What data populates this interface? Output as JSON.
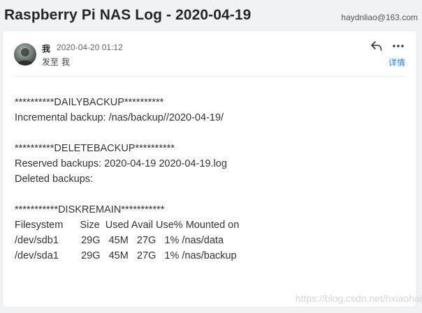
{
  "email": {
    "subject": "Raspberry Pi NAS Log - 2020-04-19",
    "to_address": "haydnliao@163.com",
    "sender": "我",
    "date": "2020-04-20 01:12",
    "recipient": "发至 我",
    "details_label": "详情",
    "icons": {
      "reply": "reply-icon",
      "more": "more-icon"
    },
    "body_lines": [
      "**********DAILYBACKUP**********",
      "Incremental backup: /nas/backup//2020-04-19/",
      "",
      "**********DELETEBACKUP**********",
      "Reserved backups: 2020-04-19 2020-04-19.log",
      "Deleted backups:",
      "",
      "***********DISKREMAIN***********",
      "Filesystem      Size  Used Avail Use% Mounted on",
      "/dev/sdb1        29G   45M   27G   1% /nas/data",
      "/dev/sda1        29G   45M   27G   1% /nas/backup"
    ]
  },
  "watermark": "https://blog.csdn.net/hxiaohai",
  "colors": {
    "background": "#f1f2f4",
    "card": "#ffffff",
    "link": "#2b7de1",
    "text": "#333333"
  }
}
